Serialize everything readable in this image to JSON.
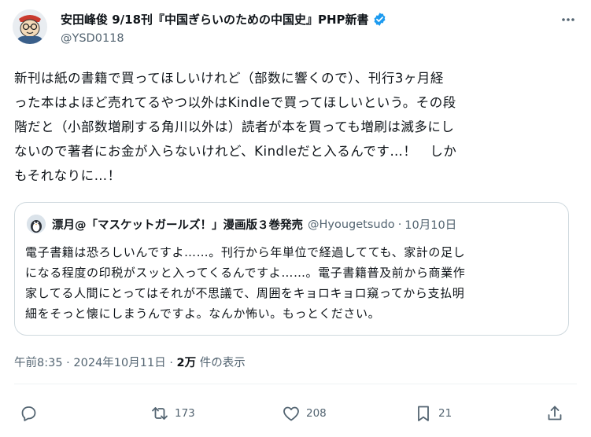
{
  "author": {
    "display_name": "安田峰俊 9/18刊『中国ぎらいのための中国史』PHP新書",
    "handle": "@YSD0118",
    "avatar_icon": "cartoon-avatar-icon",
    "verified_icon": "verified-badge-icon",
    "verified_color": "#1d9bf0"
  },
  "more_icon": "more-icon",
  "tweet": {
    "lines": [
      "新刊は紙の書籍で買ってほしいけれど（部数に響くので）、刊行3ヶ月経",
      "った本はよほど売れてるやつ以外はKindleで買ってほしいという。その段",
      "階だと（小部数増刷する角川以外は）読者が本を買っても増刷は滅多にし",
      "ないので著者にお金が入らないけれど、Kindleだと入るんです…！　しか",
      "もそれなりに…！"
    ]
  },
  "quote": {
    "display_name": "漂月@「マスケットガールズ！」漫画版３巻発売",
    "handle": "@Hyougetsudo",
    "separator": "·",
    "date": "10月10日",
    "avatar_icon": "penguin-avatar-icon",
    "lines": [
      "電子書籍は恐ろしいんですよ……。刊行から年単位で経過してても、家計の足し",
      "になる程度の印税がスッと入ってくるんですよ……。電子書籍普及前から商業作",
      "家してる人間にとってはそれが不思議で、周囲をキョロキョロ窺ってから支払明",
      "細をそっと懐にしまうんですよ。なんか怖い。もっとください。"
    ]
  },
  "meta": {
    "time": "午前8:35",
    "separator": "·",
    "date": "2024年10月11日",
    "views_count": "2万",
    "views_label": "件の表示"
  },
  "actions": {
    "reply_icon": "reply-icon",
    "repost_icon": "repost-icon",
    "repost_count": "173",
    "like_icon": "like-icon",
    "like_count": "208",
    "bookmark_icon": "bookmark-icon",
    "bookmark_count": "21",
    "share_icon": "share-icon"
  },
  "colors": {
    "text": "#0f1419",
    "secondary": "#536471",
    "border": "#cfd9de"
  }
}
